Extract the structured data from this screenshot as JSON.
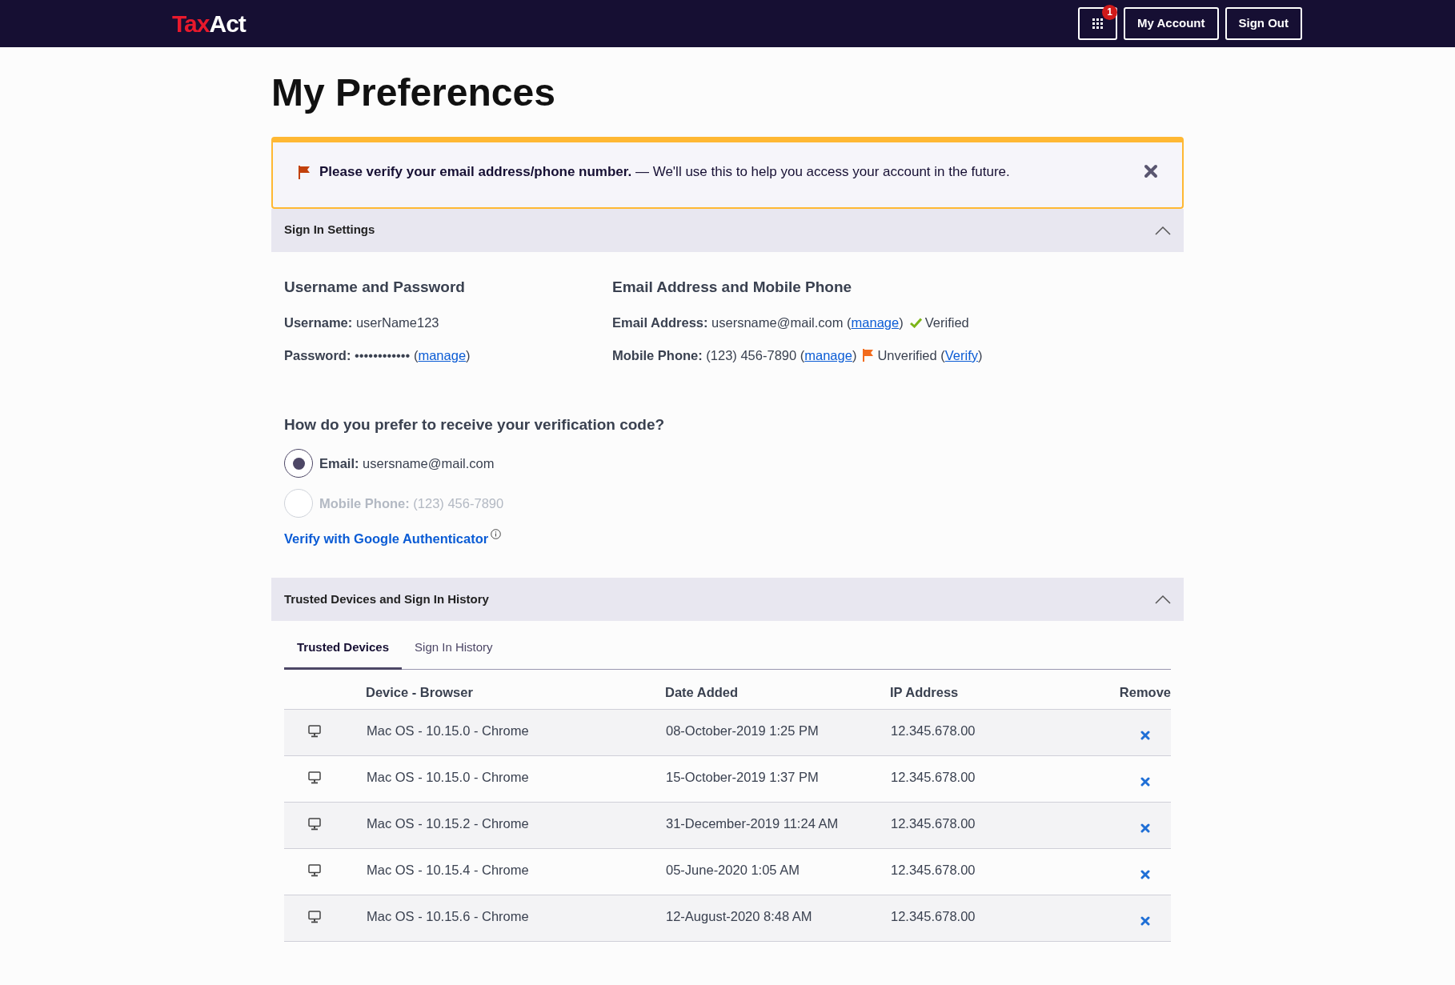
{
  "header": {
    "logo": [
      {
        "text": "Tax",
        "color": "#e8192c"
      },
      {
        "text": "Act",
        "color": "#ffffff"
      }
    ],
    "apps_badge": "1",
    "buttons": [
      "My Account",
      "Sign Out"
    ]
  },
  "title": "My Preferences",
  "alert": {
    "text": "**Please verify your email address/phone number.** — We'll use this to help you access your account in the future."
  },
  "sign_in_settings": {
    "title": "Sign In Settings",
    "expanded": true,
    "columns": [
      {
        "heading": "Username and Password",
        "lines": [
          [
            {
              "kind": "text",
              "text": "**Username:** userName123"
            }
          ],
          [
            {
              "kind": "text",
              "text": "**Password:** •••••••••••• ("
            },
            {
              "kind": "link",
              "text": "manage"
            },
            {
              "kind": "text",
              "text": ")"
            }
          ]
        ]
      },
      {
        "heading": "Email Address and Mobile Phone",
        "lines": [
          [
            {
              "kind": "text",
              "text": "**Email Address:** usersname@mail.com ("
            },
            {
              "kind": "link",
              "text": "manage"
            },
            {
              "kind": "text",
              "text": ")"
            },
            {
              "kind": "verified"
            },
            {
              "kind": "text",
              "text": "Verified"
            }
          ],
          [
            {
              "kind": "text",
              "text": "**Mobile Phone:** (123) 456-7890 ("
            },
            {
              "kind": "link",
              "text": "manage"
            },
            {
              "kind": "text",
              "text": ")"
            },
            {
              "kind": "unverified"
            },
            {
              "kind": "text",
              "text": "Unverified ("
            },
            {
              "kind": "link",
              "text": "Verify"
            },
            {
              "kind": "text",
              "text": ")"
            }
          ]
        ]
      }
    ],
    "question": "How do you prefer to receive your verification code?",
    "options": [
      {
        "text": "**Email:** usersname@mail.com",
        "selected": true,
        "disabled": false
      },
      {
        "text": "**Mobile Phone:** (123) 456-7890",
        "selected": false,
        "disabled": true
      }
    ],
    "authenticator_link": "Verify with Google Authenticator"
  },
  "trusted_devices": {
    "title": "Trusted Devices and Sign In History",
    "expanded": true,
    "tabs": [
      {
        "label": "Trusted Devices",
        "selected": true
      },
      {
        "label": "Sign In History",
        "selected": false
      }
    ],
    "table": {
      "columns": [
        "Device - Browser",
        "Date Added",
        "IP Address",
        "Remove"
      ],
      "rows": [
        {
          "device": "Mac OS - 10.15.0 - Chrome",
          "date_added": "08-October-2019 1:25 PM",
          "ip_address": "12.345.678.00"
        },
        {
          "device": "Mac OS - 10.15.0 - Chrome",
          "date_added": "15-October-2019 1:37 PM",
          "ip_address": "12.345.678.00"
        },
        {
          "device": "Mac OS - 10.15.2 - Chrome",
          "date_added": "31-December-2019 11:24 AM",
          "ip_address": "12.345.678.00"
        },
        {
          "device": "Mac OS - 10.15.4 - Chrome",
          "date_added": "05-June-2020 1:05 AM",
          "ip_address": "12.345.678.00"
        },
        {
          "device": "Mac OS - 10.15.6 - Chrome",
          "date_added": "12-August-2020 8:48 AM",
          "ip_address": "12.345.678.00"
        }
      ]
    }
  }
}
